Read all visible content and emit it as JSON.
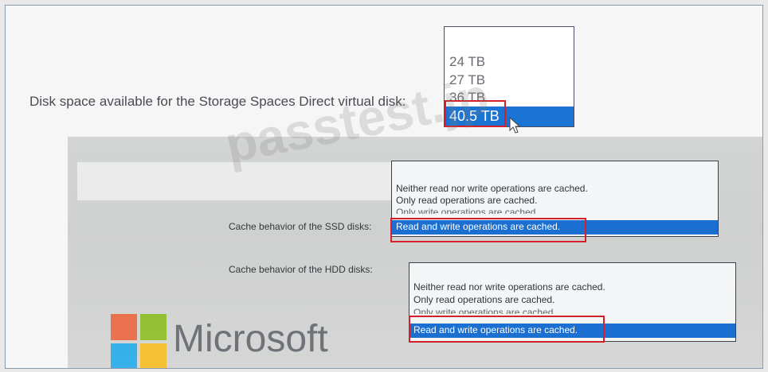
{
  "disk_space": {
    "label": "Disk space available for the Storage Spaces Direct virtual disk:",
    "options": [
      "24 TB",
      "27 TB",
      "36 TB"
    ],
    "selected": "40.5 TB"
  },
  "ssd_cache": {
    "label": "Cache behavior of the SSD disks:",
    "options": [
      "Neither read nor write operations are cached.",
      "Only read operations are cached.",
      "Only write operations are cached."
    ],
    "selected": "Read and write operations are cached."
  },
  "hdd_cache": {
    "label": "Cache behavior of the HDD disks:",
    "options": [
      "Neither read nor write operations are cached.",
      "Only read operations are cached.",
      "Only write operations are cached."
    ],
    "selected": "Read and write operations are cached."
  },
  "watermark": "passtest.jp",
  "logo": {
    "name": "Microsoft",
    "colors": [
      "#f25022",
      "#7fba00",
      "#00a4ef",
      "#ffb900"
    ]
  },
  "colors": {
    "selection": "#1a74d4",
    "highlight_box": "#d4202a"
  }
}
